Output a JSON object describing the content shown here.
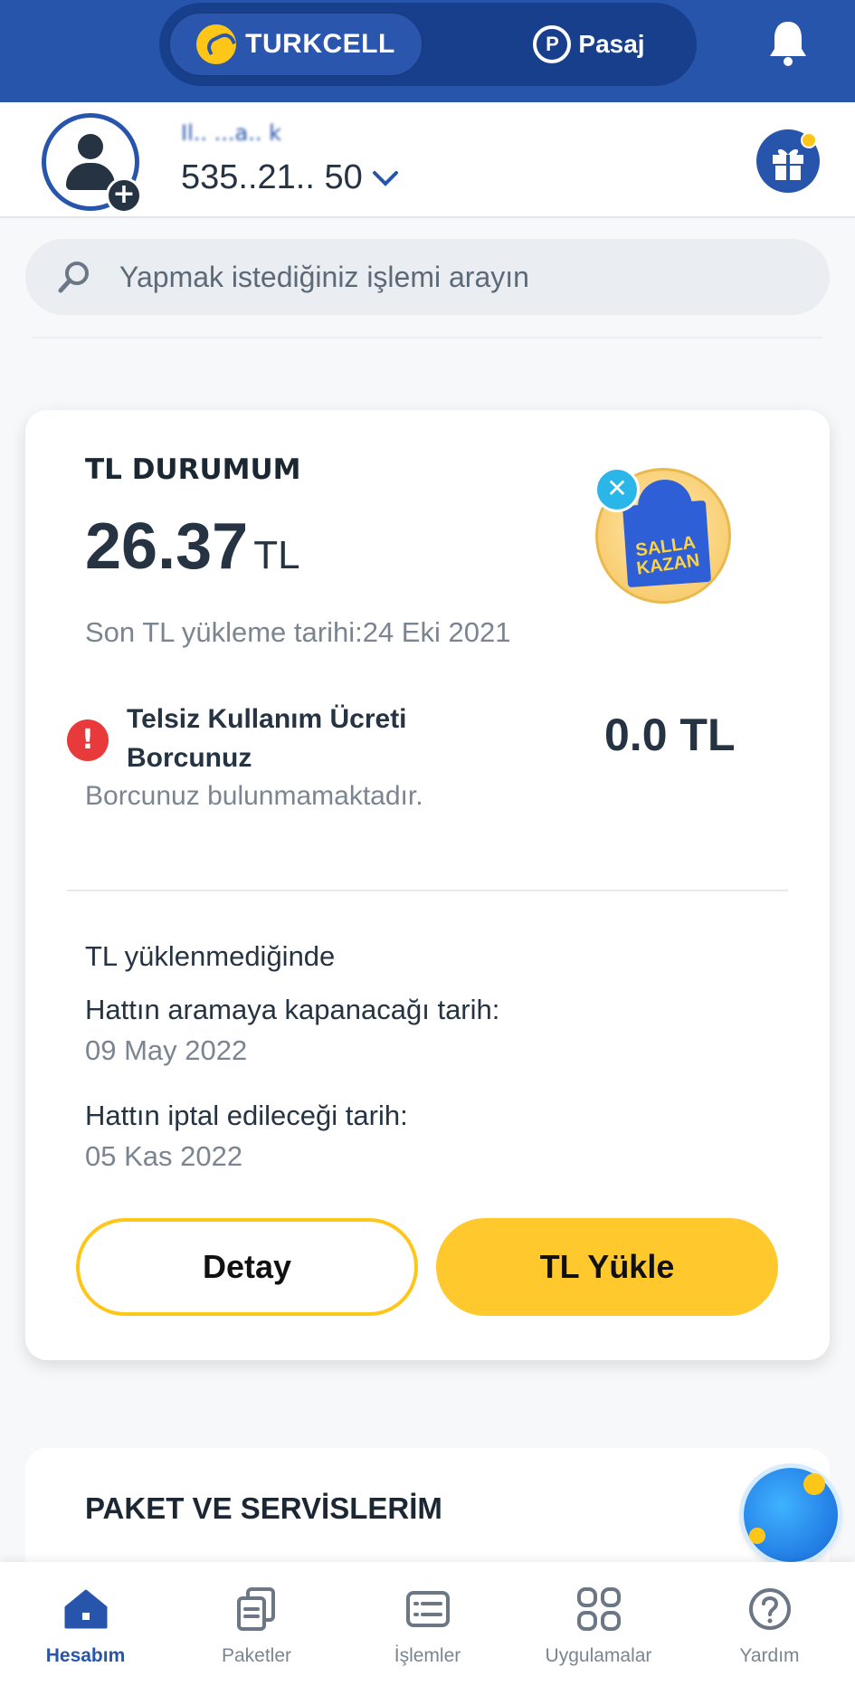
{
  "header": {
    "tabs": [
      {
        "label": "TURKCELL",
        "active": true
      },
      {
        "label": "Pasaj",
        "active": false
      }
    ],
    "accent_color": "#2855ac",
    "brand_yellow": "#ffc61a"
  },
  "profile": {
    "name_masked": "Il.. ...a.. k",
    "phone": "535..21.. 50"
  },
  "search": {
    "placeholder": "Yapmak istediğiniz işlemi arayın"
  },
  "tl_card": {
    "title": "TL DURUMUM",
    "balance": "26.37",
    "balance_unit": "TL",
    "last_load": "Son TL yükleme tarihi:24 Eki 2021",
    "promo_text": "SALLA KAZAN",
    "debt_title": "Telsiz Kullanım Ücreti Borcunuz",
    "debt_amount": "0.0 TL",
    "debt_note": "Borcunuz bulunmamaktadır.",
    "no_load_heading": "TL yüklenmediğinde",
    "close_label": "Hattın aramaya kapanacağı tarih:",
    "close_date": "09 May 2022",
    "cancel_label": "Hattın iptal edileceği tarih:",
    "cancel_date": "05 Kas 2022",
    "detail_button": "Detay",
    "load_button": "TL Yükle"
  },
  "packages_card": {
    "title": "PAKET VE SERVİSLERİM"
  },
  "bottom_nav": [
    {
      "label": "Hesabım",
      "icon": "home-icon",
      "active": true
    },
    {
      "label": "Paketler",
      "icon": "packages-icon",
      "active": false
    },
    {
      "label": "İşlemler",
      "icon": "transactions-icon",
      "active": false
    },
    {
      "label": "Uygulamalar",
      "icon": "apps-icon",
      "active": false
    },
    {
      "label": "Yardım",
      "icon": "help-icon",
      "active": false
    }
  ]
}
